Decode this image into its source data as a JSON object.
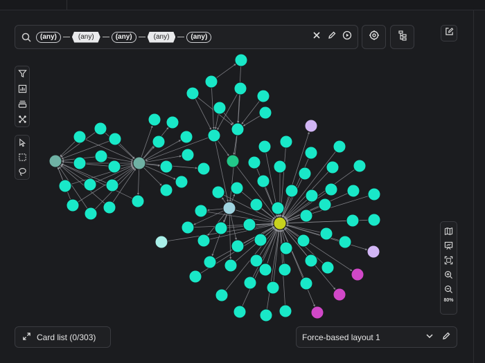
{
  "search": {
    "chips": [
      {
        "label": "(any)",
        "shape": "node"
      },
      {
        "label": "(any)",
        "shape": "edge"
      },
      {
        "label": "(any)",
        "shape": "node"
      },
      {
        "label": "(any)",
        "shape": "edge"
      },
      {
        "label": "(any)",
        "shape": "node"
      }
    ]
  },
  "card_list": {
    "label": "Card list (0/303)"
  },
  "layout": {
    "selected": "Force-based layout 1"
  },
  "zoom": {
    "label": "80%"
  },
  "colors": {
    "node_default": "#19e8c8",
    "node_gray_teal": "#6fb1a4",
    "node_green": "#22c98a",
    "node_light_blue": "#9fd4e0",
    "node_pale_cyan": "#a8efe8",
    "node_yellow": "#c8d11e",
    "node_lavender": "#d2b6f5",
    "node_magenta": "#d148c8",
    "edge": "#8c8d93"
  },
  "icons": {
    "searchbar": [
      "search-icon",
      "clear-icon",
      "pencil-icon",
      "play-icon"
    ],
    "left_tools_top": [
      "filter-icon",
      "chart-icon",
      "layers-icon",
      "transform-icon"
    ],
    "left_tools_select": [
      "pointer-icon",
      "marquee-select-icon",
      "lasso-icon"
    ],
    "right_tools": [
      "map-icon",
      "presentation-icon",
      "fit-screen-icon",
      "zoom-in-icon",
      "zoom-out-icon"
    ]
  }
}
